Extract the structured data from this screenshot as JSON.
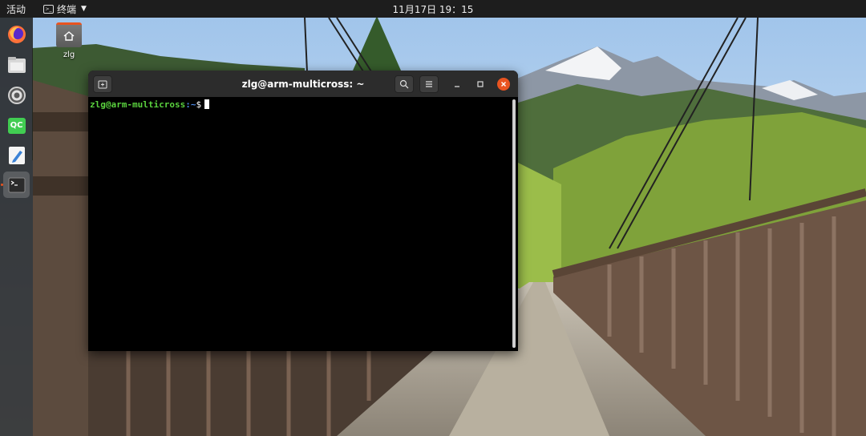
{
  "topbar": {
    "activities": "活动",
    "app_menu_label": "终端",
    "clock": "11月17日  19：15"
  },
  "dock": {
    "items": [
      {
        "name": "firefox",
        "icon": "firefox-icon"
      },
      {
        "name": "files",
        "icon": "files-icon"
      },
      {
        "name": "settings",
        "icon": "settings-gear-icon"
      },
      {
        "name": "qt-creator",
        "icon": "qt-icon",
        "label": "QC"
      },
      {
        "name": "text-editor",
        "icon": "text-editor-icon"
      },
      {
        "name": "terminal",
        "icon": "terminal-icon",
        "active": true
      }
    ]
  },
  "desktop": {
    "icons": [
      {
        "label": "zlg",
        "icon": "home-folder-icon"
      }
    ]
  },
  "terminal": {
    "title": "zlg@arm-multicross: ~",
    "prompt_user_host": "zlg@arm-multicross",
    "prompt_path": ":~",
    "prompt_symbol": "$"
  },
  "colors": {
    "accent": "#e95420",
    "prompt_green": "#5ad13e",
    "prompt_blue": "#4d8be8",
    "topbar": "#1d1d1d"
  }
}
